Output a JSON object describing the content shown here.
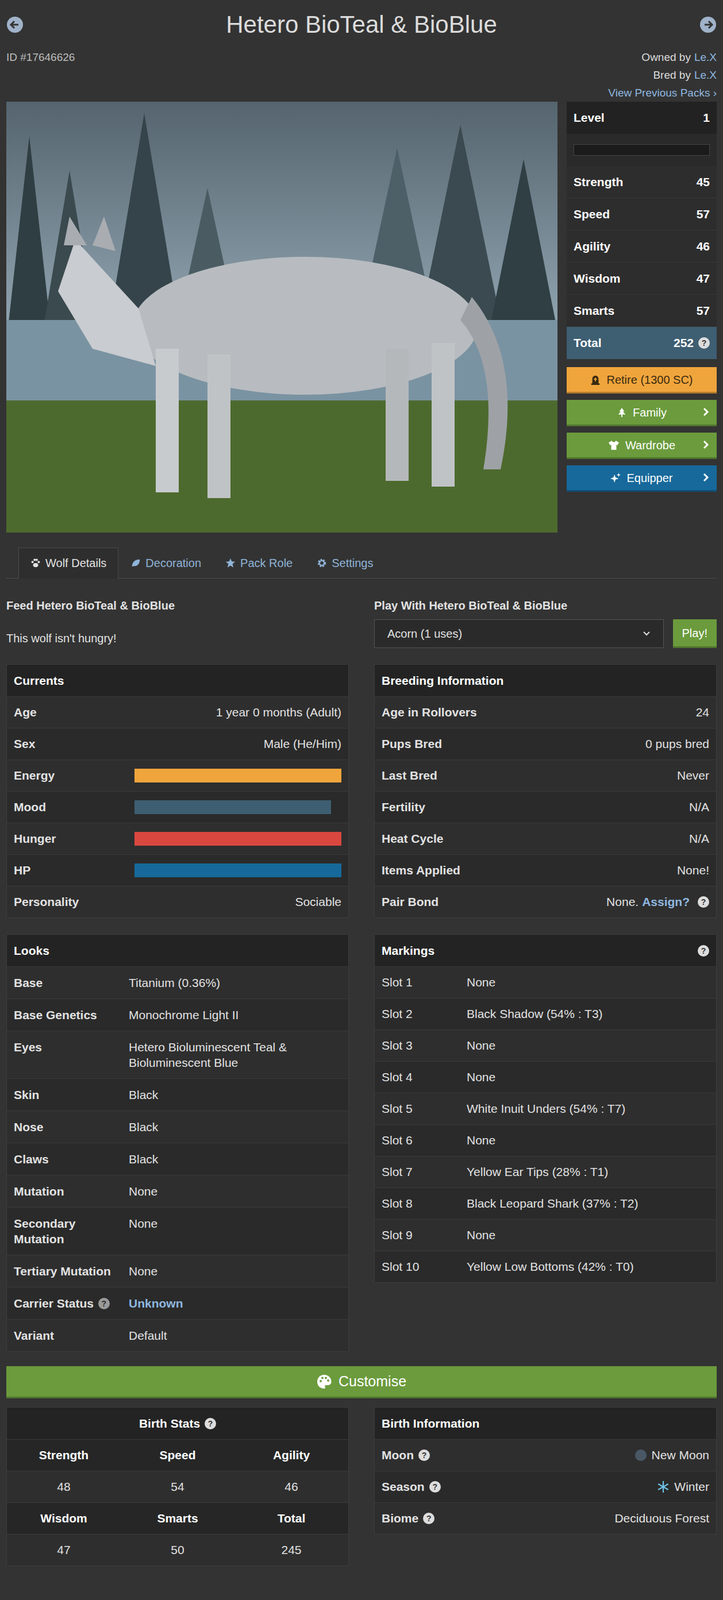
{
  "header": {
    "title": "Hetero BioTeal & BioBlue",
    "id": "ID #17646626",
    "owned_label": "Owned by",
    "owner": "Le.X",
    "bred_label": "Bred by",
    "breeder": "Le.X",
    "previous_packs": "View Previous Packs ›"
  },
  "sidebar": {
    "level": {
      "label": "Level",
      "value": "1",
      "level": 0
    },
    "stats": [
      {
        "label": "Strength",
        "value": "45"
      },
      {
        "label": "Speed",
        "value": "57"
      },
      {
        "label": "Agility",
        "value": "46"
      },
      {
        "label": "Wisdom",
        "value": "47"
      },
      {
        "label": "Smarts",
        "value": "57"
      }
    ],
    "total": {
      "label": "Total",
      "value": "252",
      "help": "?"
    },
    "buttons": [
      {
        "label": "Retire (1300 SC)",
        "kind": "warning",
        "color": "#f0a53c"
      },
      {
        "label": "Family",
        "kind": "nav",
        "color": "#6b9b3c"
      },
      {
        "label": "Wardrobe",
        "kind": "nav",
        "color": "#6b9b3c"
      },
      {
        "label": "Equipper",
        "kind": "nav",
        "color": "#17699b"
      }
    ]
  },
  "tabs": [
    {
      "label": "Wolf Details",
      "selected": true
    },
    {
      "label": "Decoration",
      "selected": false
    },
    {
      "label": "Pack Role",
      "selected": false
    },
    {
      "label": "Settings",
      "selected": false
    }
  ],
  "feed": {
    "title": "Feed Hetero BioTeal & BioBlue",
    "message": "This wolf isn't hungry!"
  },
  "play": {
    "title": "Play With Hetero BioTeal & BioBlue",
    "toy": "Acorn (1 uses)",
    "button": "Play!"
  },
  "currents": {
    "title": "Currents",
    "rows": [
      {
        "label": "Age",
        "kind": "text",
        "value": "1 year 0 months (Adult)"
      },
      {
        "label": "Sex",
        "kind": "text",
        "value": "Male (He/Him)"
      },
      {
        "label": "Energy",
        "kind": "bar",
        "level": 1,
        "color": "#f0a53c"
      },
      {
        "label": "Mood",
        "kind": "bar",
        "level": 0.95,
        "color": "#3e5e72"
      },
      {
        "label": "Hunger",
        "kind": "bar",
        "level": 1,
        "color": "#d9473f"
      },
      {
        "label": "HP",
        "kind": "bar",
        "level": 1,
        "color": "#17699b"
      },
      {
        "label": "Personality",
        "kind": "text",
        "value": "Sociable"
      }
    ]
  },
  "breeding": {
    "title": "Breeding Information",
    "rows": [
      {
        "label": "Age in Rollovers",
        "value": "24"
      },
      {
        "label": "Pups Bred",
        "value": "0 pups bred"
      },
      {
        "label": "Last Bred",
        "value": "Never"
      },
      {
        "label": "Fertility",
        "value": "N/A"
      },
      {
        "label": "Heat Cycle",
        "value": "N/A"
      },
      {
        "label": "Items Applied",
        "value": "None!"
      }
    ],
    "pair_bond": {
      "label": "Pair Bond",
      "value": "None.",
      "link": "Assign?",
      "help": "?"
    }
  },
  "looks": {
    "title": "Looks",
    "rows": [
      {
        "label": "Base",
        "value": "Titanium (0.36%)"
      },
      {
        "label": "Base Genetics",
        "value": "Monochrome Light II"
      },
      {
        "label": "Eyes",
        "value": "Hetero Bioluminescent Teal & Bioluminescent Blue"
      },
      {
        "label": "Skin",
        "value": "Black"
      },
      {
        "label": "Nose",
        "value": "Black"
      },
      {
        "label": "Claws",
        "value": "Black"
      },
      {
        "label": "Mutation",
        "value": "None"
      },
      {
        "label": "Secondary Mutation",
        "value": "None"
      },
      {
        "label": "Tertiary Mutation",
        "value": "None"
      },
      {
        "label": "Carrier Status",
        "value": "Unknown",
        "help": "?",
        "link": true
      },
      {
        "label": "Variant",
        "value": "Default"
      }
    ]
  },
  "markings": {
    "title": "Markings",
    "help": "?",
    "slots": [
      {
        "label": "Slot 1",
        "value": "None"
      },
      {
        "label": "Slot 2",
        "value": "Black Shadow (54% : T3)"
      },
      {
        "label": "Slot 3",
        "value": "None"
      },
      {
        "label": "Slot 4",
        "value": "None"
      },
      {
        "label": "Slot 5",
        "value": "White Inuit Unders (54% : T7)"
      },
      {
        "label": "Slot 6",
        "value": "None"
      },
      {
        "label": "Slot 7",
        "value": "Yellow Ear Tips (28% : T1)"
      },
      {
        "label": "Slot 8",
        "value": "Black Leopard Shark (37% : T2)"
      },
      {
        "label": "Slot 9",
        "value": "None"
      },
      {
        "label": "Slot 10",
        "value": "Yellow Low Bottoms (42% : T0)"
      }
    ]
  },
  "customise": "Customise",
  "birth_stats": {
    "title": "Birth Stats",
    "help": "?",
    "rows": [
      {
        "labels": [
          "Strength",
          "Speed",
          "Agility"
        ],
        "values": [
          "48",
          "54",
          "46"
        ]
      },
      {
        "labels": [
          "Wisdom",
          "Smarts",
          "Total"
        ],
        "values": [
          "47",
          "50",
          "245"
        ]
      }
    ]
  },
  "birth_info": {
    "title": "Birth Information",
    "rows": [
      {
        "label": "Moon",
        "help": "?",
        "value": "New Moon"
      },
      {
        "label": "Season",
        "help": "?",
        "value": "Winter"
      },
      {
        "label": "Biome",
        "help": "?",
        "value": "Deciduous Forest"
      }
    ]
  }
}
